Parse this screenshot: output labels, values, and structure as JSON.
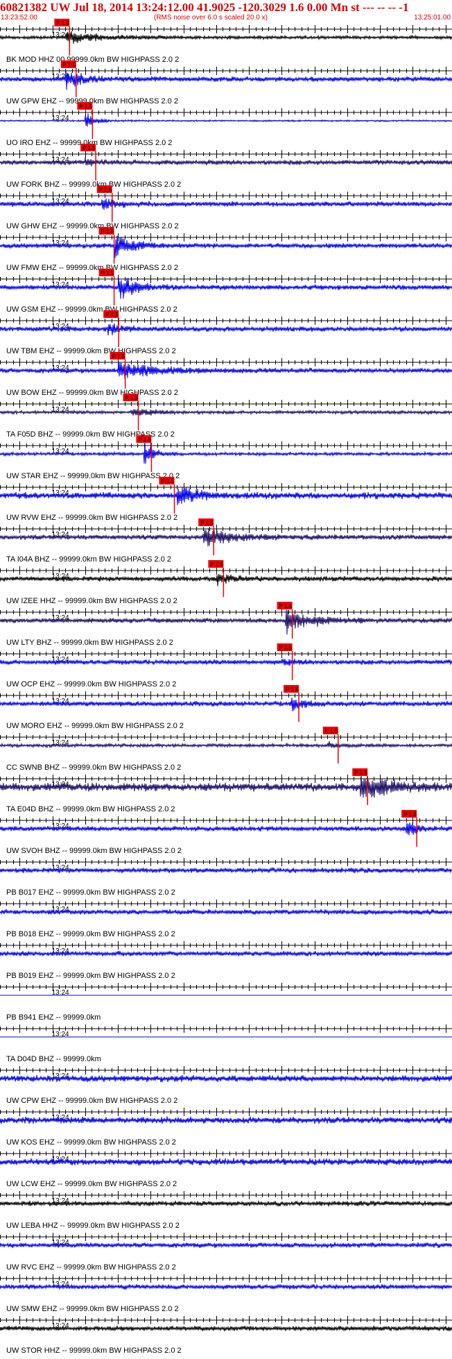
{
  "header": {
    "title": "60821382 UW Jul 18, 2014 13:24:12.00   41.9025 -120.3029  1.6 0.00 Mn st --- -- --  -1",
    "start_time": "13:23:52.00",
    "scale_note": "(RMS noise over 6.0 s scaled 20.0 x)",
    "end_time": "13:25:01.00",
    "color": "#dd0000"
  },
  "chart_data": {
    "type": "waveform",
    "time_window": {
      "start": "13:23:52.00",
      "end": "13:25:01.00",
      "seconds": 69
    },
    "tick_minute_label": "13:24",
    "pick_label": "P 1.5",
    "colors": {
      "blue": "#0000ee",
      "navy": "#1a0d66",
      "black": "#000000",
      "pick": "#ee0000"
    },
    "channels": [
      {
        "label": "BK MOD HHZ 00 99999.0km BW  HIGHPASS  2.0  2",
        "color": "black",
        "pick_s": 8.5,
        "event_s": 10.0,
        "amp": 9,
        "noise": 2,
        "dur": 14
      },
      {
        "label": "UW GPW EHZ -- 99999.0km BW  HIGHPASS  2.0  2",
        "color": "blue",
        "pick_s": 9.5,
        "event_s": 10.0,
        "amp": 16,
        "noise": 3,
        "dur": 6
      },
      {
        "label": "UO IRO EHZ -- 99999.0km BW  HIGHPASS  2.0  2",
        "color": "blue",
        "pick_s": 12.0,
        "event_s": 13.0,
        "amp": 14,
        "noise": 1,
        "dur": 4
      },
      {
        "label": "UW FORK BHZ -- 99999.0km BW  HIGHPASS  2.0  2",
        "color": "navy",
        "pick_s": 12.5,
        "event_s": 13.0,
        "amp": 4,
        "noise": 3,
        "dur": 5
      },
      {
        "label": "UW GHW EHZ -- 99999.0km BW  HIGHPASS  2.0  2",
        "color": "blue",
        "pick_s": 15.0,
        "event_s": 15.5,
        "amp": 8,
        "noise": 3,
        "dur": 6
      },
      {
        "label": "UW FMW EHZ -- 99999.0km BW  HIGHPASS  2.0  2",
        "color": "blue",
        "pick_s": 15.3,
        "event_s": 17.5,
        "amp": 24,
        "noise": 3,
        "dur": 6
      },
      {
        "label": "UW GSM EHZ -- 99999.0km BW  HIGHPASS  2.0  2",
        "color": "blue",
        "pick_s": 15.3,
        "event_s": 18.0,
        "amp": 24,
        "noise": 3,
        "dur": 6
      },
      {
        "label": "UW TBM EHZ -- 99999.0km BW  HIGHPASS  2.0  2",
        "color": "blue",
        "pick_s": 16.0,
        "event_s": 16.5,
        "amp": 10,
        "noise": 3,
        "dur": 5
      },
      {
        "label": "UW BOW EHZ -- 99999.0km BW  HIGHPASS  2.0  2",
        "color": "blue",
        "pick_s": 17.0,
        "event_s": 18.0,
        "amp": 14,
        "noise": 3,
        "dur": 14
      },
      {
        "label": "TA F05D BHZ -- 99999.0km BW  HIGHPASS  2.0  2",
        "color": "navy",
        "pick_s": 19.0,
        "event_s": 20.0,
        "amp": 7,
        "noise": 2,
        "dur": 8
      },
      {
        "label": "UW STAR EHZ -- 99999.0km BW  HIGHPASS  2.0  2",
        "color": "blue",
        "pick_s": 21.0,
        "event_s": 22.0,
        "amp": 24,
        "noise": 2,
        "dur": 3
      },
      {
        "label": "UW RVW EHZ -- 99999.0km BW  HIGHPASS  2.0  2",
        "color": "blue",
        "pick_s": 24.5,
        "event_s": 27.0,
        "amp": 24,
        "noise": 4,
        "dur": 6
      },
      {
        "label": "TA I04A BHZ -- 99999.0km BW  HIGHPASS  2.0  2",
        "color": "navy",
        "pick_s": 30.5,
        "event_s": 31.0,
        "amp": 14,
        "noise": 3,
        "dur": 12
      },
      {
        "label": "UW IZEE HHZ -- 99999.0km BW  HIGHPASS  2.0  2",
        "color": "black",
        "pick_s": 32.0,
        "event_s": 33.0,
        "amp": 10,
        "noise": 3,
        "dur": 5
      },
      {
        "label": "UW LTY BHZ -- 99999.0km BW  HIGHPASS  2.0  2",
        "color": "navy",
        "pick_s": 42.5,
        "event_s": 43.5,
        "amp": 20,
        "noise": 3,
        "dur": 9
      },
      {
        "label": "UW OCP EHZ -- 99999.0km BW  HIGHPASS  2.0  2",
        "color": "blue",
        "pick_s": 42.5,
        "event_s": 43.0,
        "amp": 4,
        "noise": 3,
        "dur": 5
      },
      {
        "label": "UW MORO EHZ -- 99999.0km BW  HIGHPASS  2.0  2",
        "color": "blue",
        "pick_s": 43.5,
        "event_s": 44.5,
        "amp": 12,
        "noise": 3,
        "dur": 4
      },
      {
        "label": "CC SWNB BHZ -- 99999.0km BW  HIGHPASS  2.0  2",
        "color": "navy",
        "pick_s": 49.5,
        "event_s": 50.0,
        "amp": 6,
        "noise": 2,
        "dur": 4
      },
      {
        "label": "TA E04D BHZ -- 99999.0km BW  HIGHPASS  2.0  2",
        "color": "navy",
        "pick_s": 54.0,
        "event_s": 55.0,
        "amp": 22,
        "noise": 5,
        "dur": 10
      },
      {
        "label": "UW SVOH BHZ -- 99999.0km BW  HIGHPASS  2.0  2",
        "color": "blue",
        "pick_s": 61.5,
        "event_s": 62.0,
        "amp": 18,
        "noise": 3,
        "dur": 3
      },
      {
        "label": "PB B017 EHZ -- 99999.0km BW  HIGHPASS  2.0  2",
        "color": "blue",
        "noise": 3
      },
      {
        "label": "PB B018 EHZ -- 99999.0km BW  HIGHPASS  2.0  2",
        "color": "blue",
        "noise": 3
      },
      {
        "label": "PB B019 EHZ -- 99999.0km BW  HIGHPASS  2.0  2",
        "color": "blue",
        "noise": 3
      },
      {
        "label": "PB B941 EHZ -- 99999.0km",
        "color": "blue",
        "noise": 0
      },
      {
        "label": "TA D04D BHZ -- 99999.0km",
        "color": "blue",
        "noise": 0
      },
      {
        "label": "UW CPW EHZ -- 99999.0km BW  HIGHPASS  2.0  2",
        "color": "blue",
        "noise": 4
      },
      {
        "label": "UW KOS EHZ -- 99999.0km BW  HIGHPASS  2.0  2",
        "color": "blue",
        "noise": 4
      },
      {
        "label": "UW LCW EHZ -- 99999.0km BW  HIGHPASS  2.0  2",
        "color": "blue",
        "noise": 4
      },
      {
        "label": "UW LEBA HHZ -- 99999.0km BW  HIGHPASS  2.0  2",
        "color": "black",
        "noise": 3
      },
      {
        "label": "UW RVC EHZ -- 99999.0km BW  HIGHPASS  2.0  2",
        "color": "blue",
        "noise": 3
      },
      {
        "label": "UW SMW EHZ -- 99999.0km BW  HIGHPASS  2.0  2",
        "color": "blue",
        "noise": 3
      },
      {
        "label": "UW STOR HHZ -- 99999.0km BW  HIGHPASS  2.0  2",
        "color": "black",
        "noise": 3
      }
    ]
  }
}
